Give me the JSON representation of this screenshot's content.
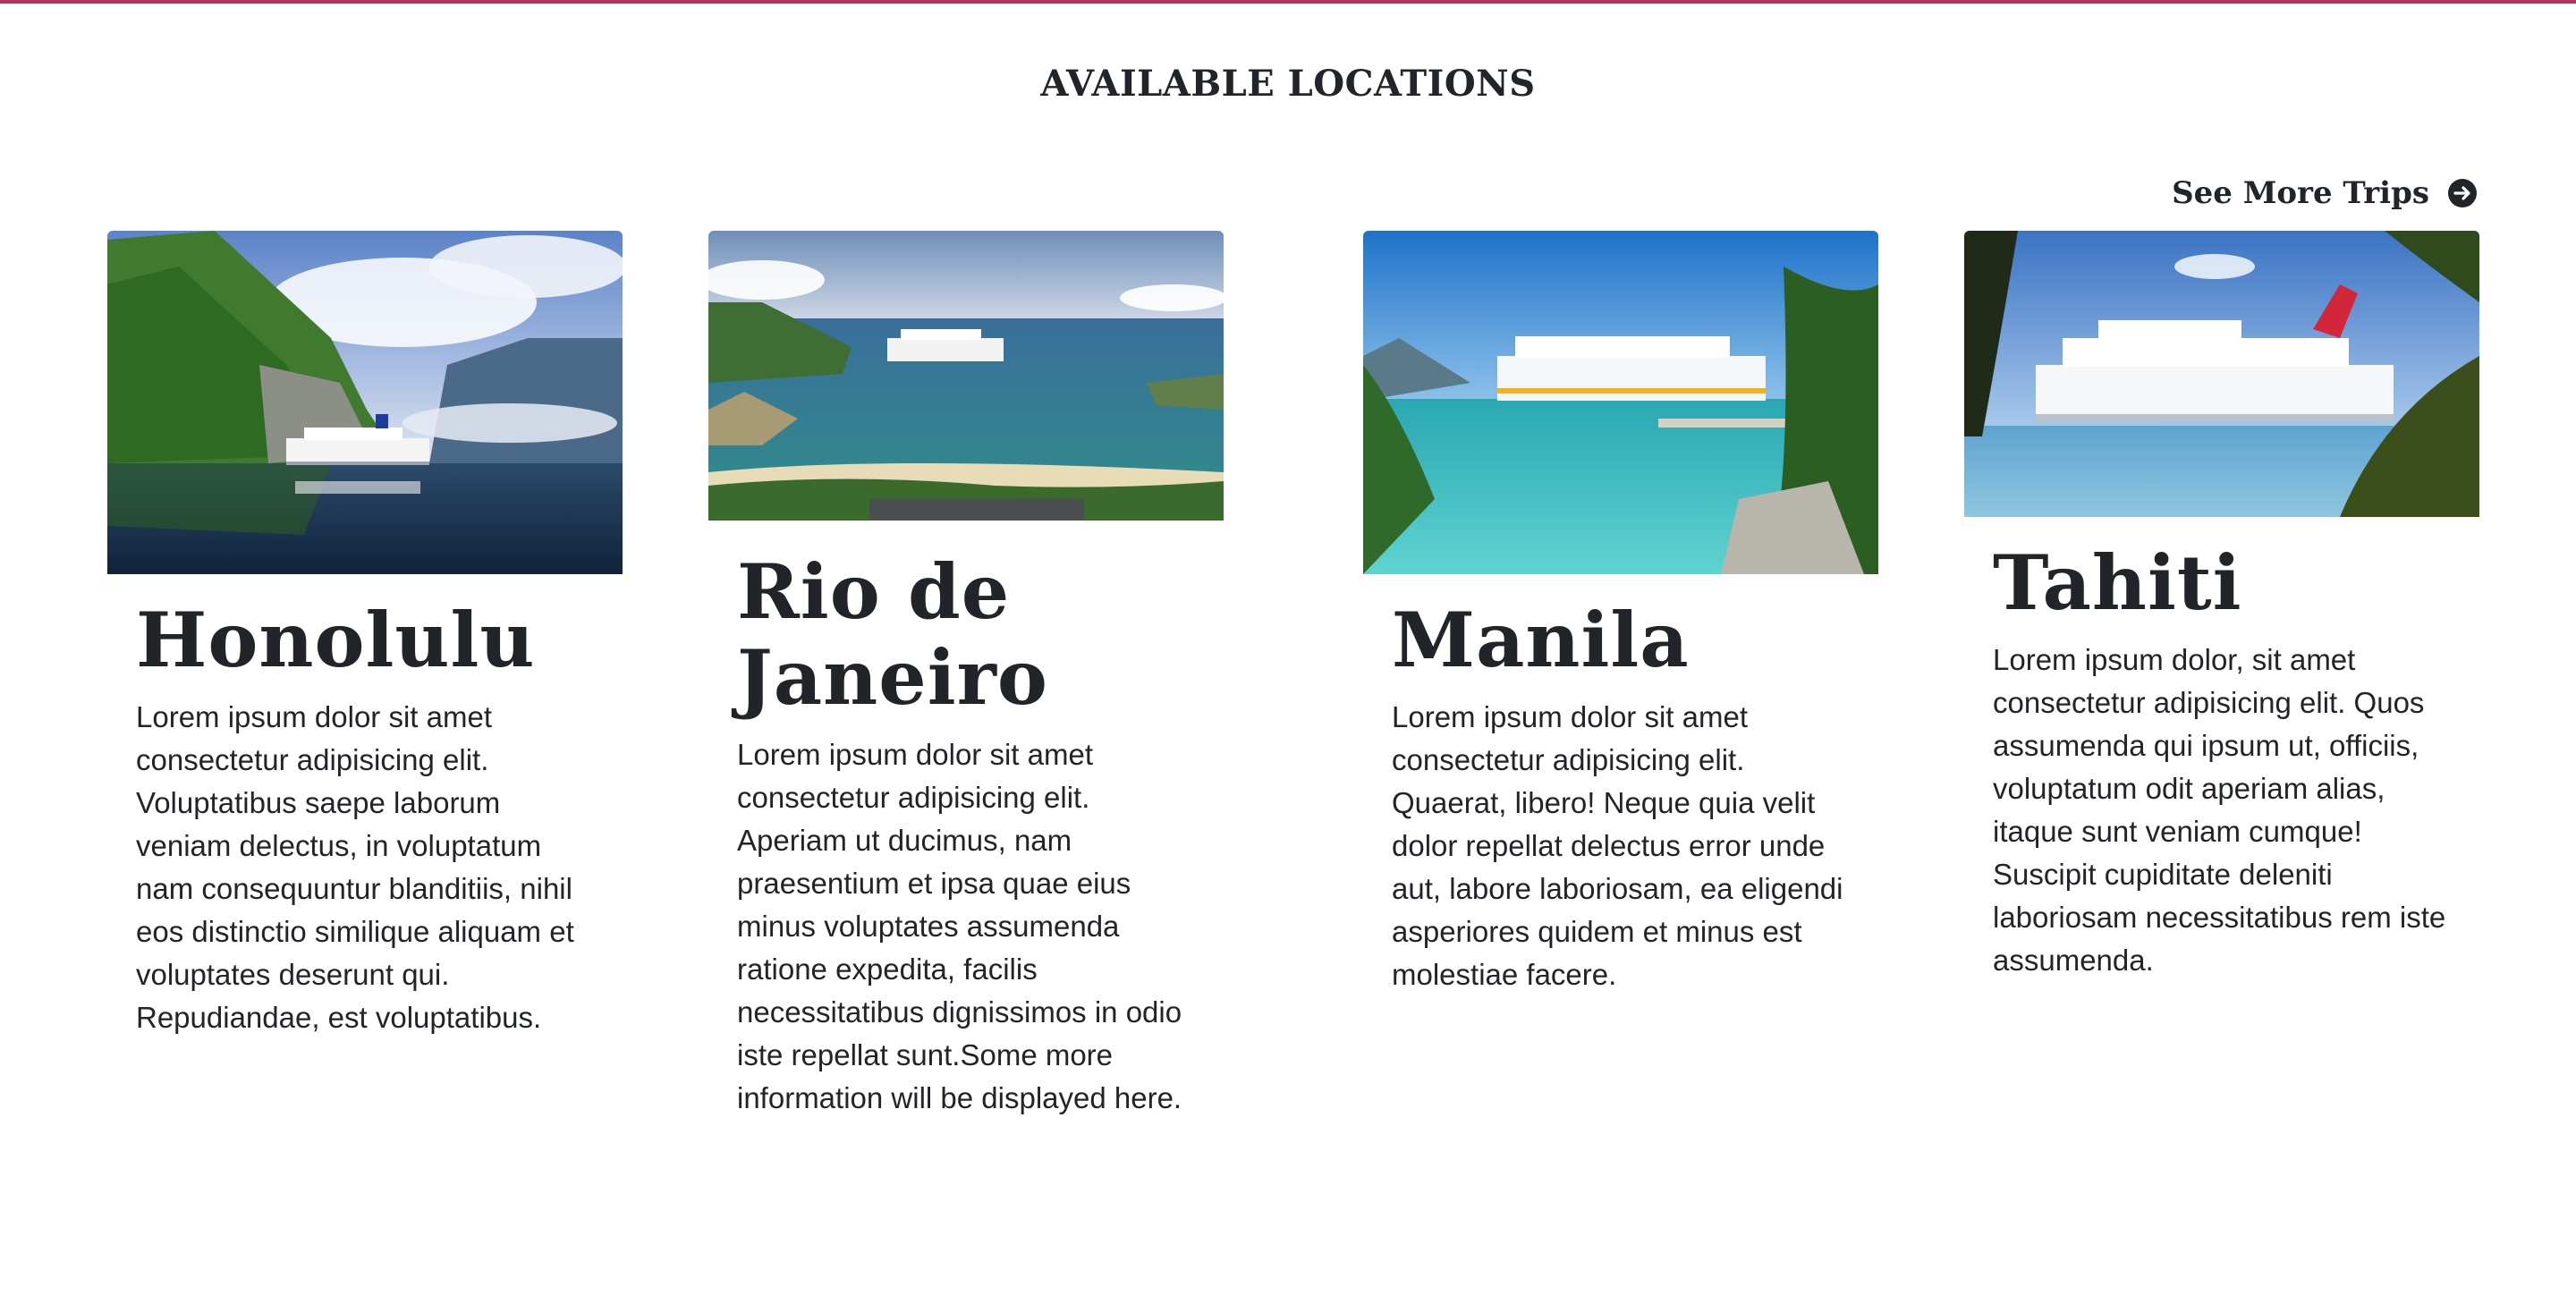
{
  "section": {
    "title": "AVAILABLE LOCATIONS",
    "see_more_label": "See More Trips",
    "see_more_icon": "arrow-right-circle-icon"
  },
  "colors": {
    "accent_border": "#b0325f",
    "text": "#212529"
  },
  "locations": [
    {
      "name": "Honolulu",
      "image": "cruise-ship-fjord-photo",
      "description": "Lorem ipsum dolor sit amet consectetur adipisicing elit. Voluptatibus saepe laborum veniam delectus, in voluptatum nam consequuntur blanditiis, nihil eos distinctio similique aliquam et voluptates deserunt qui. Repudiandae, est voluptatibus."
    },
    {
      "name": "Rio de Janeiro",
      "image": "cruise-ship-bay-photo",
      "description": "Lorem ipsum dolor sit amet consectetur adipisicing elit. Aperiam ut ducimus, nam praesentium et ipsa quae eius minus voluptates assumenda ratione expedita, facilis necessitatibus dignissimos in odio iste repellat sunt.Some more information will be displayed here."
    },
    {
      "name": "Manila",
      "image": "cruise-ship-lagoon-photo",
      "description": "Lorem ipsum dolor sit amet consectetur adipisicing elit. Quaerat, libero! Neque quia velit dolor repellat delectus error unde aut, labore laboriosam, ea eligendi asperiores quidem et minus est molestiae facere."
    },
    {
      "name": "Tahiti",
      "image": "cruise-ship-beach-photo",
      "description": "Lorem ipsum dolor, sit amet consectetur adipisicing elit. Quos assumenda qui ipsum ut, officiis, voluptatum odit aperiam alias, itaque sunt veniam cumque! Suscipit cupiditate deleniti laboriosam necessitatibus rem iste assumenda."
    }
  ]
}
